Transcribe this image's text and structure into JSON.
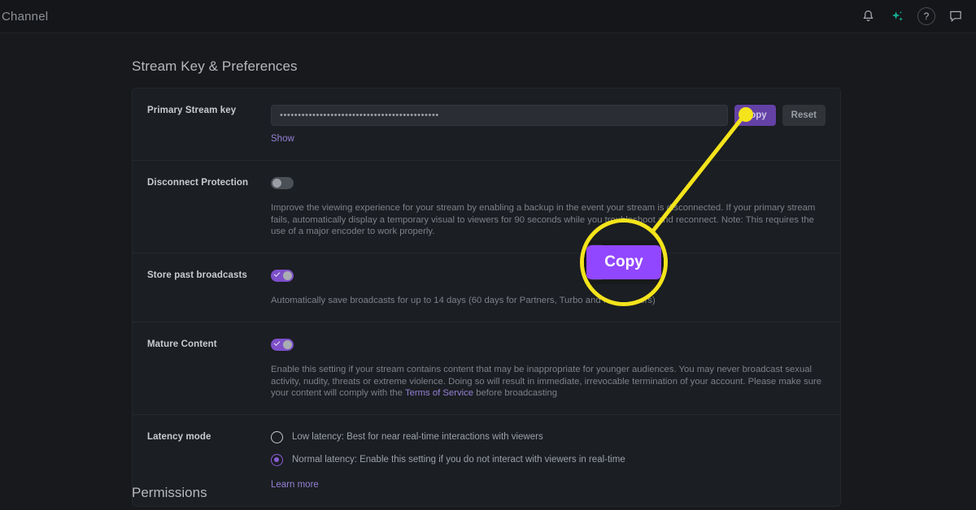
{
  "topbar": {
    "title": "Channel",
    "icons": [
      {
        "name": "notifications-icon",
        "glyph": "bell"
      },
      {
        "name": "ai-sparkle-icon",
        "glyph": "sparkle"
      },
      {
        "name": "help-icon",
        "glyph": "?"
      },
      {
        "name": "chat-icon",
        "glyph": "chat"
      }
    ]
  },
  "page": {
    "section_heading": "Stream Key & Preferences",
    "bottom_heading": "Permissions"
  },
  "stream_key": {
    "label": "Primary Stream key",
    "masked_value": "••••••••••••••••••••••••••••••••••••••••••••",
    "copy_label": "Copy",
    "reset_label": "Reset",
    "show_label": "Show"
  },
  "disconnect_protection": {
    "label": "Disconnect Protection",
    "toggle_state": "off",
    "description": "Improve the viewing experience for your stream by enabling a backup in the event your stream is disconnected. If your primary stream fails, automatically display a temporary visual to viewers for 90 seconds while you troubleshoot and reconnect. Note: This requires the use of a major encoder to work properly."
  },
  "store_past_broadcasts": {
    "label": "Store past broadcasts",
    "toggle_state": "on",
    "description": "Automatically save broadcasts for up to 14 days (60 days for Partners, Turbo and Prime users)"
  },
  "mature_content": {
    "label": "Mature Content",
    "toggle_state": "on",
    "description_before_link": "Enable this setting if your stream contains content that may be inappropriate for younger audiences. You may never broadcast sexual activity, nudity, threats or extreme violence. Doing so will result in immediate, irrevocable termination of your account. Please make sure your content will comply with the ",
    "link_label": "Terms of Service",
    "description_after_link": " before broadcasting"
  },
  "latency_mode": {
    "label": "Latency mode",
    "options": [
      {
        "label": "Low latency: Best for near real-time interactions with viewers",
        "selected": false
      },
      {
        "label": "Normal latency: Enable this setting if you do not interact with viewers in real-time",
        "selected": true
      }
    ],
    "learn_more_label": "Learn more"
  },
  "callout": {
    "magnified_label": "Copy",
    "highlight_color": "#f4e41c",
    "button_color": "#9147ff"
  }
}
